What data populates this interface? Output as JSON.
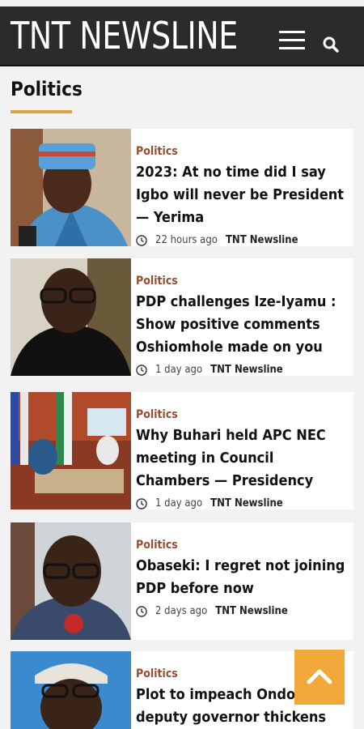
{
  "site": {
    "title": "TNT NEWSLINE"
  },
  "header": {
    "menu_icon": "hamburger-menu-icon",
    "search_icon": "search-icon"
  },
  "section": {
    "title": "Politics"
  },
  "articles": [
    {
      "category": "Politics",
      "headline": "2023: At no time did I say Igbo will never be President — Yerima",
      "time": "22 hours ago",
      "author": "TNT Newsline"
    },
    {
      "category": "Politics",
      "headline": "PDP challenges Ize-Iyamu : Show positive comments Oshiomhole made on you",
      "time": "1 day ago",
      "author": "TNT Newsline"
    },
    {
      "category": "Politics",
      "headline": "Why Buhari held APC NEC meeting in Council Chambers — Presidency",
      "time": "1 day ago",
      "author": "TNT Newsline"
    },
    {
      "category": "Politics",
      "headline": "Obaseki: I regret not joining PDP before now",
      "time": "2 days ago",
      "author": "TNT Newsline"
    },
    {
      "category": "Politics",
      "headline": "Plot to impeach Ondo deputy governor thickens",
      "time": "",
      "author": ""
    }
  ],
  "scroll_top": {
    "icon": "chevron-up-icon"
  },
  "colors": {
    "header_bg": "#2b2b2b",
    "accent": "#e0a23a",
    "category": "#9b4a2d",
    "scroll_button": "#f0a83a"
  }
}
